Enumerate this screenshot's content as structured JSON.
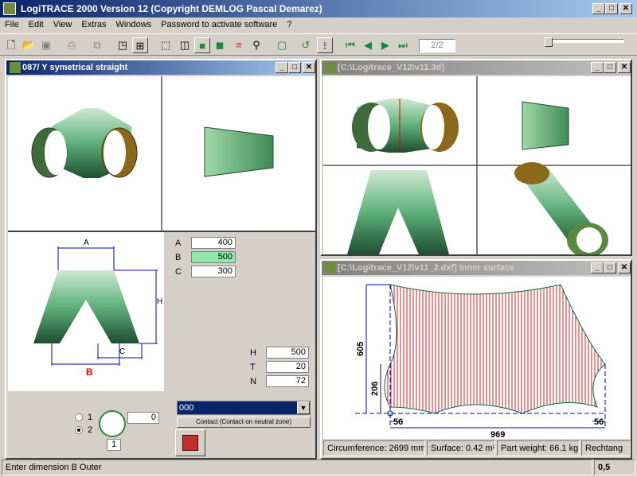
{
  "app": {
    "title": "LogiTRACE 2000  Version 12  (Copyright DEMLOG Pascal Demarez)"
  },
  "menu": [
    "File",
    "Edit",
    "View",
    "Extras",
    "Windows",
    "Password to activate software",
    "?"
  ],
  "toolbar": {
    "page": "2/2"
  },
  "win1": {
    "title": "087/ Y symetrical straight"
  },
  "win2": {
    "title": "[C:\\Logitrace_V12\\v11.3d]"
  },
  "win3": {
    "title": "[C:\\Logitrace_V12\\v11_2.dxf]  Inner surface"
  },
  "dims": {
    "a_label": "A",
    "b_label": "B",
    "c_label": "C",
    "h_label": "H",
    "a": "400",
    "b": "500",
    "c": "300",
    "h": "500",
    "t_label": "T",
    "t": "20",
    "n_label": "N",
    "n": "72"
  },
  "drawing": {
    "a": "A",
    "b": "B",
    "c": "C",
    "h": "H"
  },
  "combo": {
    "value": "000",
    "caption": "Contact (Contact on neutral zone)"
  },
  "radio": {
    "opt1": "1",
    "opt2": "2",
    "angle": "0",
    "count": "1"
  },
  "dxf": {
    "d605": "605",
    "d206": "206",
    "d56a": "56",
    "d56b": "56",
    "d969": "969"
  },
  "info": {
    "circ": "Circumference: 2699 mm",
    "surf": "Surface: 0.42 m²",
    "weight": "Part weight: 66.1 kg",
    "rect": "Rechtang"
  },
  "statusbar": {
    "message": "Enter dimension B Outer",
    "value": "0,5"
  }
}
